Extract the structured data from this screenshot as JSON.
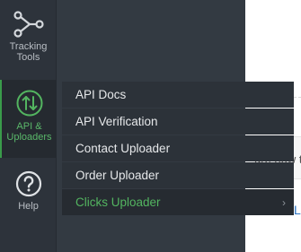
{
  "rail": {
    "items": [
      {
        "label_line1": "Tracking",
        "label_line2": "Tools",
        "icon": "share-nodes-icon"
      },
      {
        "label_line1": "API &",
        "label_line2": "Uploaders",
        "icon": "upload-download-icon"
      },
      {
        "label_line1": "Help",
        "icon": "question-circle-icon"
      }
    ]
  },
  "flyout": {
    "items": [
      {
        "label": "API Docs"
      },
      {
        "label": "API Verification"
      },
      {
        "label": "Contact Uploader"
      },
      {
        "label": "Order Uploader"
      },
      {
        "label": "Clicks Uploader",
        "chevron": "›"
      }
    ]
  },
  "page": {
    "partial_text": "ure how to",
    "partial_link": "L"
  },
  "colors": {
    "rail_bg": "#2d333b",
    "flyout_bg": "#333a42",
    "accent": "#53b560"
  }
}
